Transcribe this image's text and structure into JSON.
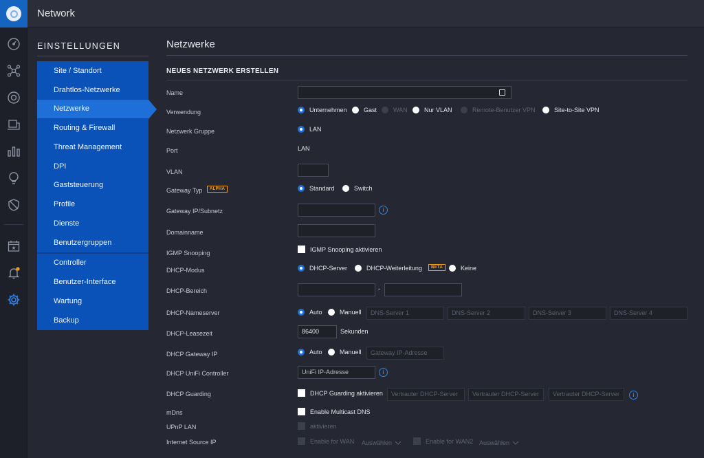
{
  "app": {
    "title": "Network"
  },
  "iconbar": [
    "dashboard-icon",
    "topology-icon",
    "devices-icon",
    "clients-icon",
    "statistics-icon",
    "insights-icon",
    "shield-icon",
    "events-icon",
    "alerts-icon",
    "settings-icon"
  ],
  "sidebar": {
    "title": "EINSTELLUNGEN",
    "group1": [
      "Site / Standort",
      "Drahtlos-Netzwerke",
      "Netzwerke",
      "Routing & Firewall",
      "Threat Management",
      "DPI",
      "Gaststeuerung",
      "Profile",
      "Dienste",
      "Benutzergruppen"
    ],
    "group2": [
      "Controller",
      "Benutzer-Interface",
      "Wartung",
      "Backup"
    ],
    "active": "Netzwerke"
  },
  "main": {
    "title": "Netzwerke",
    "section": "NEUES NETZWERK ERSTELLEN",
    "labels": {
      "name": "Name",
      "verwendung": "Verwendung",
      "gruppe": "Netzwerk Gruppe",
      "port": "Port",
      "vlan": "VLAN",
      "gateway_typ": "Gateway Typ",
      "gateway_ip": "Gateway IP/Subnetz",
      "domain": "Domainname",
      "igmp": "IGMP Snooping",
      "dhcp_modus": "DHCP-Modus",
      "dhcp_bereich": "DHCP-Bereich",
      "dhcp_ns": "DHCP-Nameserver",
      "lease": "DHCP-Leasezeit",
      "dhcp_gw": "DHCP Gateway IP",
      "dhcp_unifi": "DHCP UniFi Controller",
      "dhcp_guard": "DHCP Guarding",
      "mdns": "mDns",
      "upnp": "UPnP LAN",
      "isip": "Internet Source IP"
    },
    "verwendung_options": [
      "Unternehmen",
      "Gast",
      "WAN",
      "Nur VLAN",
      "Remote-Benutzer VPN",
      "Site-to-Site VPN"
    ],
    "verwendung_selected": "Unternehmen",
    "gruppe_option": "LAN",
    "port_value": "LAN",
    "gateway_typ_options": [
      "Standard",
      "Switch"
    ],
    "alpha_badge": "ALPHA",
    "igmp_check": "IGMP Snooping aktivieren",
    "dhcp_modus_options": [
      "DHCP-Server",
      "DHCP-Weiterleitung",
      "Keine"
    ],
    "beta_badge": "BETA",
    "range_dash": "-",
    "ns_options": [
      "Auto",
      "Manuell"
    ],
    "dns_placeholders": [
      "DNS-Server 1",
      "DNS-Server 2",
      "DNS-Server 3",
      "DNS-Server 4"
    ],
    "lease_value": "86400",
    "lease_unit": "Sekunden",
    "gw_options": [
      "Auto",
      "Manuell"
    ],
    "gw_placeholder": "Gateway IP-Adresse",
    "unifi_placeholder": "UniFi IP-Adresse",
    "guard_check": "DHCP Guarding aktivieren",
    "guard_placeholders": [
      "Vertrauter DHCP-Server",
      "Vertrauter DHCP-Server",
      "Vertrauter DHCP-Server"
    ],
    "mdns_check": "Enable Multicast DNS",
    "upnp_check": "aktivieren",
    "isip_wan": "Enable for WAN",
    "isip_wan2": "Enable for WAN2",
    "isip_select": "Auswählen",
    "info_symbol": "i",
    "name_icon": "password-manager-icon"
  },
  "colors": {
    "accent": "#1e70d8",
    "menu": "#0a52b8",
    "background": "#252833",
    "badge": "#f0a020"
  }
}
